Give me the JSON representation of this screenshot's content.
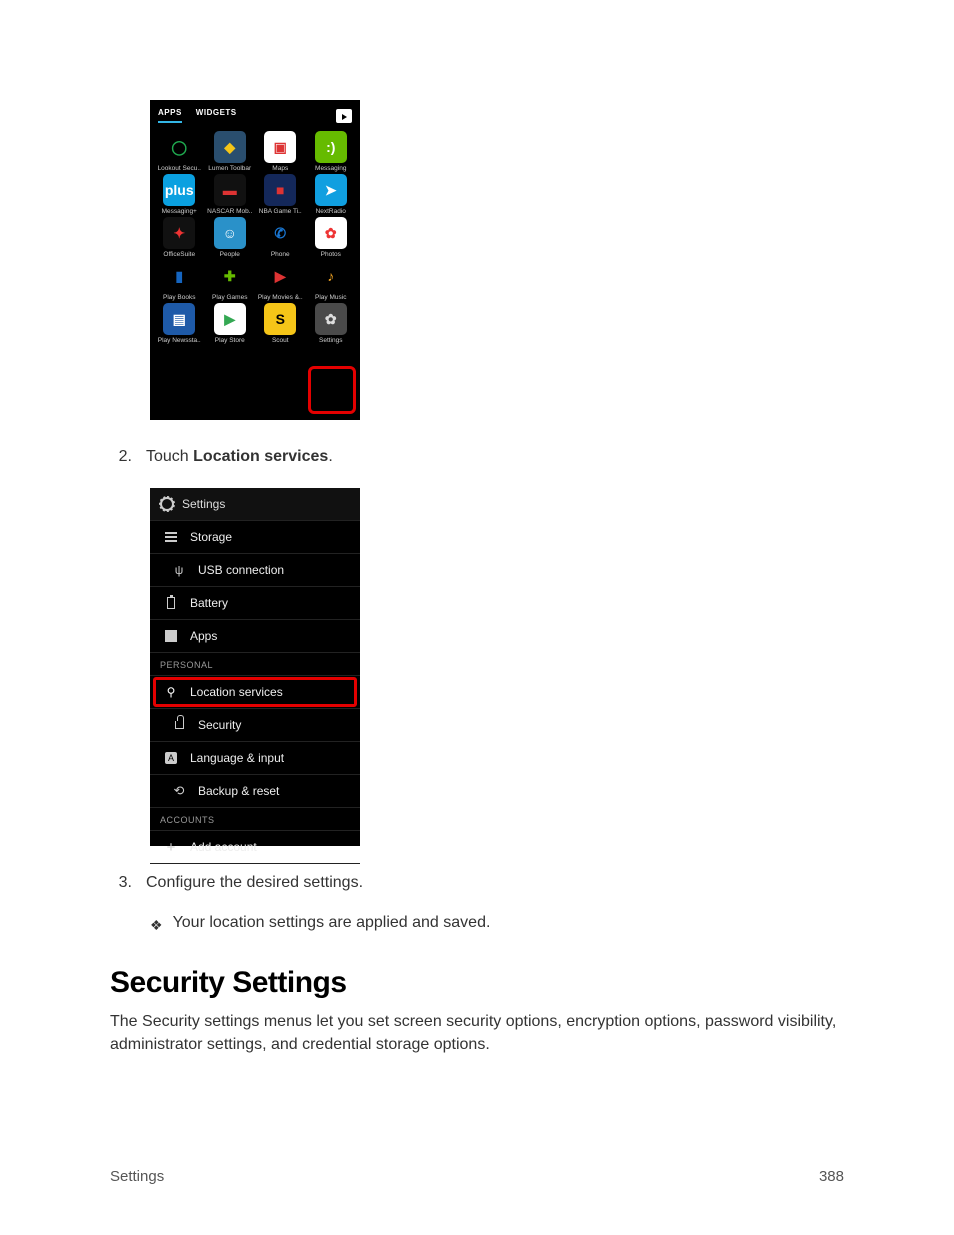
{
  "apps_shot": {
    "tabs": {
      "apps": "APPS",
      "widgets": "WIDGETS"
    },
    "apps": [
      {
        "label": "Lookout Secu..",
        "bg": "#000",
        "fg": "#1fa94f",
        "glyph": "◯"
      },
      {
        "label": "Lumen Toolbar",
        "bg": "#2a4e6e",
        "fg": "#f5c518",
        "glyph": "◆"
      },
      {
        "label": "Maps",
        "bg": "#fff",
        "fg": "#d33",
        "glyph": "▣"
      },
      {
        "label": "Messaging",
        "bg": "#6b0",
        "fg": "#fff",
        "glyph": ":)"
      },
      {
        "label": "Messaging+",
        "bg": "#0aa0e0",
        "fg": "#fff",
        "glyph": "plus"
      },
      {
        "label": "NASCAR Mob..",
        "bg": "#111",
        "fg": "#d33",
        "glyph": "▬"
      },
      {
        "label": "NBA Game Ti..",
        "bg": "#14285a",
        "fg": "#d33",
        "glyph": "■"
      },
      {
        "label": "NextRadio",
        "bg": "#109fe0",
        "fg": "#fff",
        "glyph": "➤"
      },
      {
        "label": "OfficeSuite",
        "bg": "#111",
        "fg": "#e33",
        "glyph": "✦"
      },
      {
        "label": "People",
        "bg": "#2a91c9",
        "fg": "#fff",
        "glyph": "☺"
      },
      {
        "label": "Phone",
        "bg": "#000",
        "fg": "#1976d2",
        "glyph": "✆"
      },
      {
        "label": "Photos",
        "bg": "#fff",
        "fg": "#e33",
        "glyph": "✿"
      },
      {
        "label": "Play Books",
        "bg": "#000",
        "fg": "#1565c0",
        "glyph": "▮"
      },
      {
        "label": "Play Games",
        "bg": "#000",
        "fg": "#6b0",
        "glyph": "✚"
      },
      {
        "label": "Play Movies &..",
        "bg": "#000",
        "fg": "#d33",
        "glyph": "▶"
      },
      {
        "label": "Play Music",
        "bg": "#000",
        "fg": "#f5a623",
        "glyph": "♪"
      },
      {
        "label": "Play Newssta..",
        "bg": "#1e5aa8",
        "fg": "#fff",
        "glyph": "▤"
      },
      {
        "label": "Play Store",
        "bg": "#fff",
        "fg": "#34a853",
        "glyph": "▶"
      },
      {
        "label": "Scout",
        "bg": "#f5c518",
        "fg": "#000",
        "glyph": "S"
      },
      {
        "label": "Settings",
        "bg": "#4a4a4a",
        "fg": "#ddd",
        "glyph": "✿"
      }
    ]
  },
  "settings_shot": {
    "title": "Settings",
    "items": [
      {
        "label": "Storage",
        "icon": "bars"
      },
      {
        "label": "USB connection",
        "icon": "usb",
        "indent": true
      },
      {
        "label": "Battery",
        "icon": "bat"
      },
      {
        "label": "Apps",
        "icon": "apps"
      }
    ],
    "section1": "PERSONAL",
    "personal": [
      {
        "label": "Location services",
        "icon": "pin",
        "highlight": true
      },
      {
        "label": "Security",
        "icon": "lock",
        "indent": true
      },
      {
        "label": "Language & input",
        "icon": "lang"
      },
      {
        "label": "Backup & reset",
        "icon": "reset",
        "indent": true
      }
    ],
    "section2": "ACCOUNTS",
    "accounts": [
      {
        "label": "Add account",
        "icon": "plus"
      }
    ]
  },
  "steps": {
    "s2_num": "2.",
    "s2_pre": "Touch ",
    "s2_bold": "Location services",
    "s2_post": ".",
    "s3_num": "3.",
    "s3_text": "Configure the desired settings.",
    "note": "Your location settings are applied and saved."
  },
  "section": {
    "heading": "Security Settings",
    "body": "The Security settings menus let you set screen security options, encryption options, password visibility, administrator settings, and credential storage options."
  },
  "footer": {
    "left": "Settings",
    "right": "388"
  }
}
